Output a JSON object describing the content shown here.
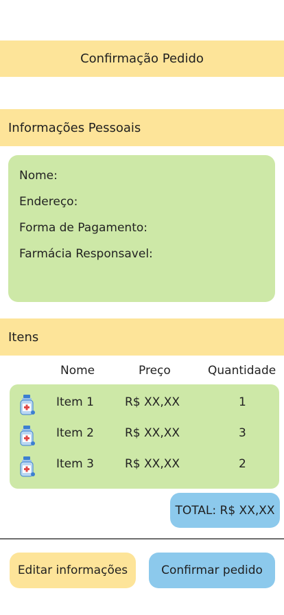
{
  "header": {
    "title": "Confirmação Pedido"
  },
  "personal": {
    "section_title": "Informações Pessoais",
    "fields": [
      {
        "label": "Nome:"
      },
      {
        "label": "Endereço:"
      },
      {
        "label": "Forma de Pagamento:"
      },
      {
        "label": "Farmácia Responsavel:"
      }
    ]
  },
  "items": {
    "section_title": "Itens",
    "columns": {
      "name": "Nome",
      "price": "Preço",
      "quantity": "Quantidade"
    },
    "rows": [
      {
        "icon": "medicine-bottle-icon",
        "name": "Item 1",
        "price": "R$ XX,XX",
        "quantity": "1"
      },
      {
        "icon": "medicine-bottle-icon",
        "name": "Item 2",
        "price": "R$ XX,XX",
        "quantity": "3"
      },
      {
        "icon": "medicine-bottle-icon",
        "name": "Item 3",
        "price": "R$ XX,XX",
        "quantity": "2"
      }
    ],
    "total": "TOTAL: R$ XX,XX"
  },
  "actions": {
    "edit_label": "Editar informações",
    "confirm_label": "Confirmar pedido"
  },
  "colors": {
    "header_yellow": "#fde499",
    "card_green": "#cde8a7",
    "button_blue": "#8cc9ec"
  }
}
